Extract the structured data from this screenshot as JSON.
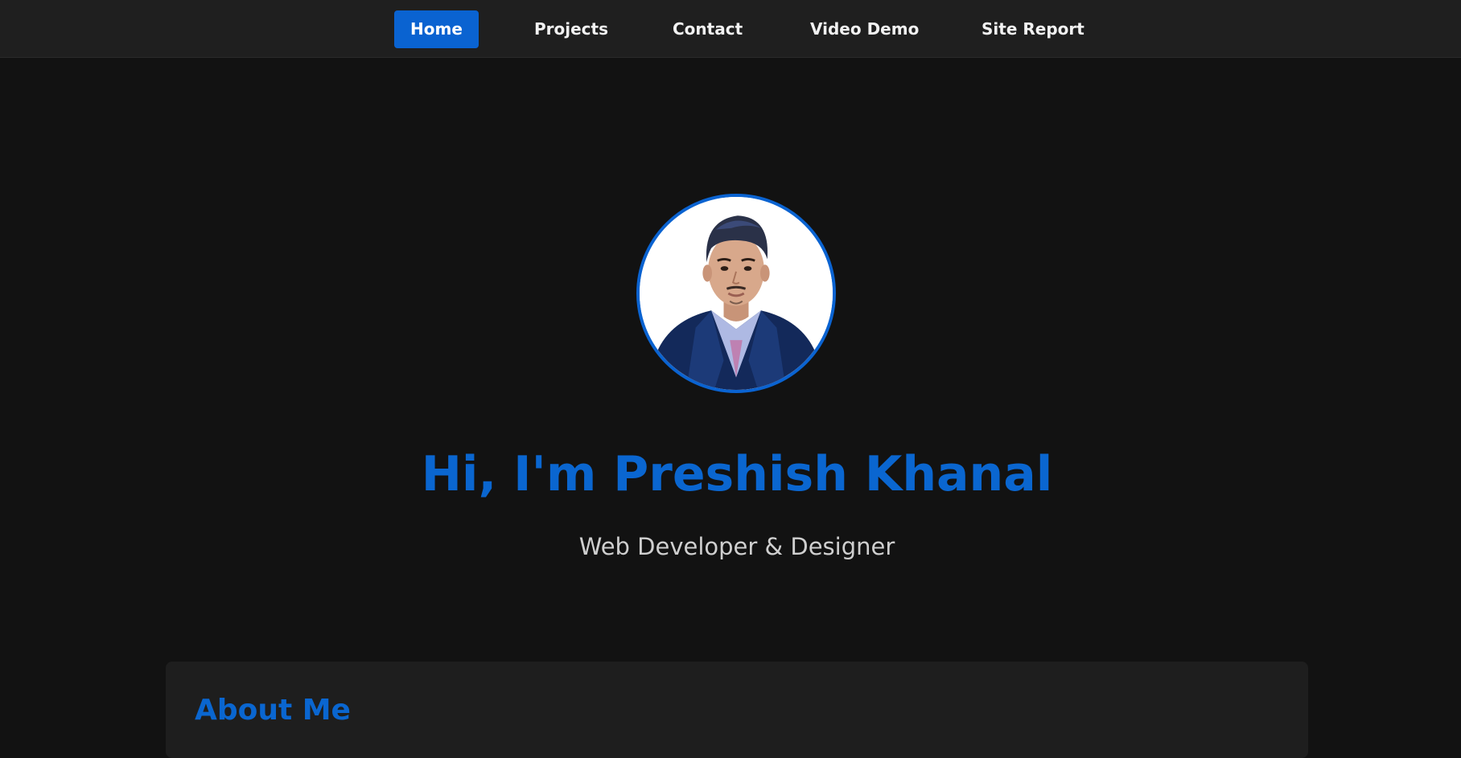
{
  "nav": {
    "items": [
      {
        "label": "Home",
        "active": true
      },
      {
        "label": "Projects",
        "active": false
      },
      {
        "label": "Contact",
        "active": false
      },
      {
        "label": "Video Demo",
        "active": false
      },
      {
        "label": "Site Report",
        "active": false
      }
    ]
  },
  "hero": {
    "title": "Hi, I'm Preshish Khanal",
    "subtitle": "Web Developer & Designer"
  },
  "about": {
    "heading": "About Me"
  },
  "colors": {
    "accent": "#0a63d1",
    "background": "#121212",
    "nav_background": "#1f1f1f",
    "card_background": "#1e1e1e"
  }
}
